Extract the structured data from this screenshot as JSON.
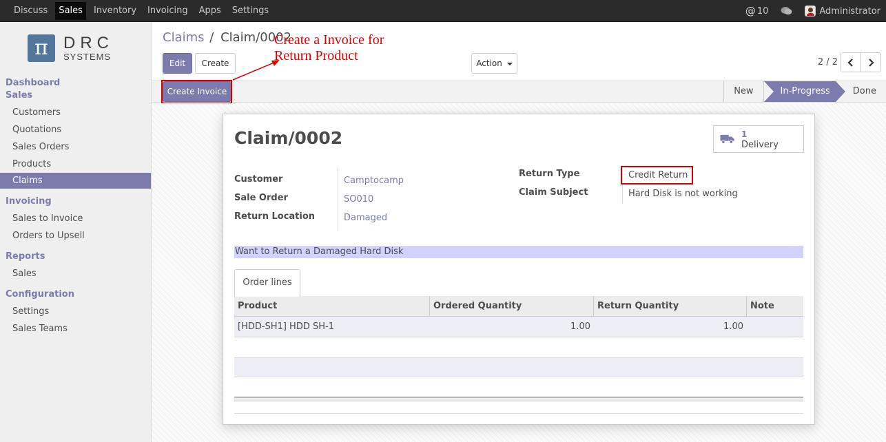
{
  "topbar": {
    "menu": [
      "Discuss",
      "Sales",
      "Inventory",
      "Invoicing",
      "Apps",
      "Settings"
    ],
    "active": "Sales",
    "messages_count": "10",
    "user": "Administrator"
  },
  "logo": {
    "line1": "DRC",
    "line2": "SYSTEMS",
    "symbol": "π"
  },
  "sidebar": {
    "dashboard": "Dashboard",
    "sales_header": "Sales",
    "sales_items": [
      "Customers",
      "Quotations",
      "Sales Orders",
      "Products",
      "Claims"
    ],
    "invoicing_header": "Invoicing",
    "invoicing_items": [
      "Sales to Invoice",
      "Orders to Upsell"
    ],
    "reports_header": "Reports",
    "reports_items": [
      "Sales"
    ],
    "config_header": "Configuration",
    "config_items": [
      "Settings",
      "Sales Teams"
    ]
  },
  "breadcrumb": {
    "parent": "Claims",
    "sep": "/",
    "current": "Claim/0002"
  },
  "toolbar": {
    "edit": "Edit",
    "create": "Create",
    "action": "Action",
    "pager": "2 / 2"
  },
  "annotation": {
    "line1": "Create a Invoice for",
    "line2": "Return Product"
  },
  "statusbar": {
    "create_invoice": "Create Invoice",
    "stages": [
      "New",
      "In-Progress",
      "Done"
    ],
    "current_stage": "In-Progress"
  },
  "form": {
    "title": "Claim/0002",
    "delivery_count": "1",
    "delivery_label": "Delivery",
    "customer_label": "Customer",
    "customer": "Camptocamp",
    "sale_order_label": "Sale Order",
    "sale_order": "SO010",
    "return_location_label": "Return Location",
    "return_location": "Damaged",
    "return_type_label": "Return Type",
    "return_type": "Credit Return",
    "claim_subject_label": "Claim Subject",
    "claim_subject": "Hard Disk is not working",
    "description": "Want to Return a Damaged Hard Disk",
    "tab": "Order lines"
  },
  "order_lines": {
    "columns": [
      "Product",
      "Ordered Quantity",
      "Return Quantity",
      "Note"
    ],
    "rows": [
      {
        "product": "[HDD-SH1] HDD SH-1",
        "ordered": "1.00",
        "returned": "1.00",
        "note": ""
      }
    ]
  },
  "colors": {
    "accent": "#7c7bad",
    "highlight": "#d2d2ff",
    "annotation": "#e00000"
  },
  "icons": [
    "at-icon",
    "chat-icon",
    "truck-icon",
    "chevron-left-icon",
    "chevron-right-icon",
    "caret-down-icon"
  ]
}
